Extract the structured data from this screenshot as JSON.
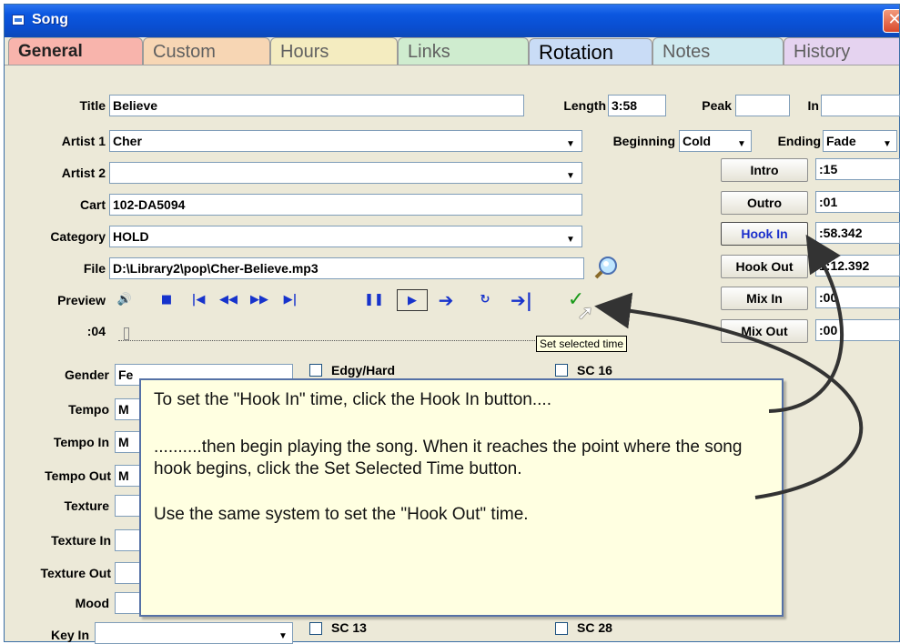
{
  "window": {
    "title": "Song",
    "close_glyph": "✕"
  },
  "tabs": [
    {
      "label": "General",
      "color": "#f8b4ac"
    },
    {
      "label": "Custom",
      "color": "#f7d6b4"
    },
    {
      "label": "Hours",
      "color": "#f4ecc0"
    },
    {
      "label": "Links",
      "color": "#cfeccf"
    },
    {
      "label": "Rotation",
      "color": "#c9dcf6"
    },
    {
      "label": "Notes",
      "color": "#cfeaf0"
    },
    {
      "label": "History",
      "color": "#e5d3f0"
    }
  ],
  "fields": {
    "title_label": "Title",
    "title_value": "Believe",
    "length_label": "Length",
    "length_value": "3:58",
    "peak_label": "Peak",
    "peak_value": "",
    "in_label": "In",
    "in_value": "",
    "artist1_label": "Artist 1",
    "artist1_value": "Cher",
    "beginning_label": "Beginning",
    "beginning_value": "Cold",
    "ending_label": "Ending",
    "ending_value": "Fade",
    "artist2_label": "Artist 2",
    "artist2_value": "",
    "cart_label": "Cart",
    "cart_value": "102-DA5094",
    "category_label": "Category",
    "category_value": "HOLD",
    "file_label": "File",
    "file_value": "D:\\Library2\\pop\\Cher-Believe.mp3",
    "preview_label": "Preview",
    "position_value": ":04"
  },
  "timing": {
    "intro_label": "Intro",
    "intro_value": ":15",
    "outro_label": "Outro",
    "outro_value": ":01",
    "hookin_label": "Hook In",
    "hookin_value": ":58.342",
    "hookout_label": "Hook Out",
    "hookout_value": "1:12.392",
    "mixin_label": "Mix In",
    "mixin_value": ":00",
    "mixout_label": "Mix Out",
    "mixout_value": ":00"
  },
  "transport_icons": [
    "speaker-icon",
    "stop-icon",
    "skip-start-icon",
    "rewind-icon",
    "fast-forward-icon",
    "skip-end-icon",
    "pause-icon",
    "play-selection-icon",
    "jump-to-icon",
    "loop-icon",
    "go-to-end-icon",
    "set-time-checkmark-icon"
  ],
  "tooltip": "Set selected time",
  "left_form": {
    "gender_label": "Gender",
    "gender_value": "Fe",
    "tempo_label": "Tempo",
    "tempo_value": "M",
    "tempoin_label": "Tempo In",
    "tempoin_value": "M",
    "tempoout_label": "Tempo Out",
    "tempoout_value": "M",
    "texture_label": "Texture",
    "texturein_label": "Texture In",
    "textureout_label": "Texture Out",
    "mood_label": "Mood",
    "keyin_label": "Key In"
  },
  "checkboxes": {
    "edgy_hard": "Edgy/Hard",
    "sc16": "SC 16",
    "sc13": "SC 13",
    "sc28": "SC 28"
  },
  "callout": {
    "line1": "To set the \"Hook In\" time, click the Hook In button....",
    "line2": "..........then begin playing the song.  When it reaches the point where the song hook begins, click the Set Selected Time button.",
    "line3": "Use the same system to set the \"Hook Out\" time."
  },
  "colors": {
    "accent": "#1b2fcc",
    "titlebar": "#0a4ed0",
    "callout_bg": "#ffffe1"
  }
}
